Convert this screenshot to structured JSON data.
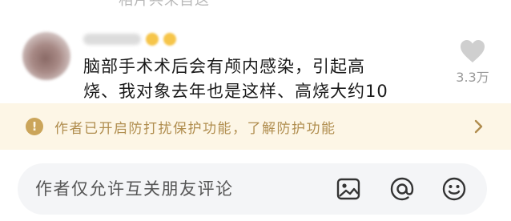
{
  "top_partial_text": "相片共来自这",
  "comment": {
    "text_line1": "脑部手术术后会有颅内感染，引起高",
    "text_line2": "烧、我对象去年也是这样、高烧大约10",
    "likes": "3.3万"
  },
  "notice": {
    "icon_glyph": "!",
    "text": "作者已开启防打扰保护功能，了解防护功能"
  },
  "input_bar": {
    "placeholder": "作者仅允许互关朋友评论"
  },
  "colors": {
    "notice_bg": "#fdf6e6",
    "notice_text": "#b08d4e",
    "input_bg": "#f4f5f7",
    "heart": "#cfcfcf"
  },
  "icons": [
    "info-icon",
    "chevron-right-icon",
    "heart-icon",
    "image-icon",
    "at-icon",
    "emoji-icon"
  ]
}
